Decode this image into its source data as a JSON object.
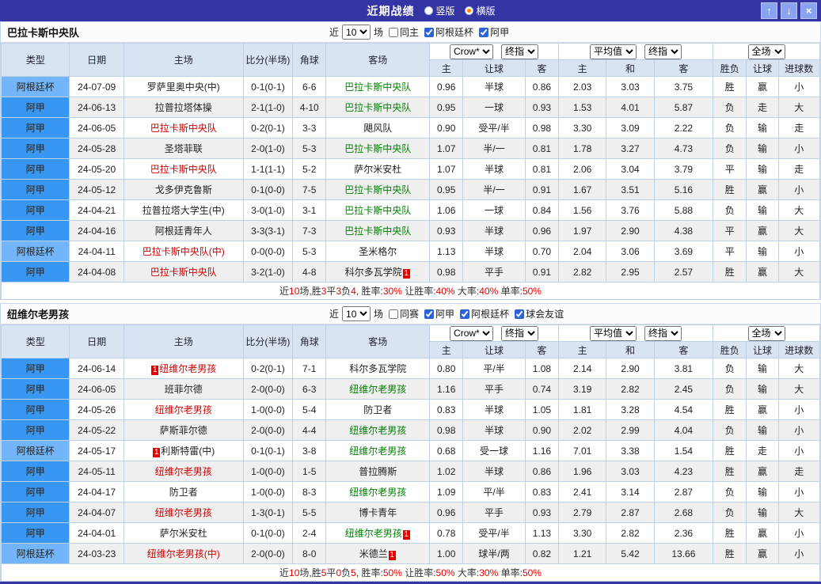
{
  "titlebar": {
    "title": "近期战绩",
    "radios": [
      {
        "label": "竖版",
        "selected": false
      },
      {
        "label": "横版",
        "selected": true
      }
    ],
    "buttons": {
      "up": "↑",
      "down": "↓",
      "close": "×"
    }
  },
  "sections": [
    {
      "team": "巴拉卡斯中央队",
      "filter": {
        "near_label": "近",
        "count": "10",
        "games_label": "场",
        "checkboxes": [
          {
            "label": "同主",
            "checked": false
          },
          {
            "label": "阿根廷杯",
            "checked": true
          },
          {
            "label": "阿甲",
            "checked": true
          }
        ]
      },
      "header": {
        "cols": [
          "类型",
          "日期",
          "主场",
          "比分(半场)",
          "角球",
          "客场"
        ],
        "selects1": [
          "Crow*",
          "终指"
        ],
        "selects2": [
          "平均值",
          "终指"
        ],
        "selects3": [
          "全场"
        ],
        "sub": [
          "主",
          "让球",
          "客",
          "主",
          "和",
          "客",
          "胜负",
          "让球",
          "进球数"
        ]
      },
      "rows": [
        {
          "type": "阿根廷杯",
          "type_style": "cup",
          "date": "24-07-09",
          "home": {
            "name": "罗萨里奥中央(中)",
            "color": "k"
          },
          "score": "0-1(0-1)",
          "corner": "6-6",
          "away": {
            "name": "巴拉卡斯中央队",
            "color": "g"
          },
          "odds": [
            "0.96",
            "半球",
            "0.86",
            "2.03",
            "3.03",
            "3.75"
          ],
          "results": [
            [
              "胜",
              "red"
            ],
            [
              "赢",
              "red"
            ],
            [
              "小",
              "green"
            ]
          ]
        },
        {
          "type": "阿甲",
          "type_style": "lg",
          "date": "24-06-13",
          "home": {
            "name": "拉普拉塔体操",
            "color": "k"
          },
          "score": "2-1(1-0)",
          "corner": "4-10",
          "away": {
            "name": "巴拉卡斯中央队",
            "color": "g"
          },
          "odds": [
            "0.95",
            "一球",
            "0.93",
            "1.53",
            "4.01",
            "5.87"
          ],
          "results": [
            [
              "负",
              "green"
            ],
            [
              "走",
              "green"
            ],
            [
              "大",
              "red"
            ]
          ]
        },
        {
          "type": "阿甲",
          "type_style": "lg",
          "date": "24-06-05",
          "home": {
            "name": "巴拉卡斯中央队",
            "color": "r"
          },
          "score": "0-2(0-1)",
          "corner": "3-3",
          "away": {
            "name": "飓风队",
            "color": "k"
          },
          "odds": [
            "0.90",
            "受平/半",
            "0.98",
            "3.30",
            "3.09",
            "2.22"
          ],
          "results": [
            [
              "负",
              "green"
            ],
            [
              "输",
              "green"
            ],
            [
              "走",
              "green"
            ]
          ]
        },
        {
          "type": "阿甲",
          "type_style": "lg",
          "date": "24-05-28",
          "home": {
            "name": "圣塔菲联",
            "color": "k"
          },
          "score": "2-0(1-0)",
          "corner": "5-3",
          "away": {
            "name": "巴拉卡斯中央队",
            "color": "g"
          },
          "odds": [
            "1.07",
            "半/一",
            "0.81",
            "1.78",
            "3.27",
            "4.73"
          ],
          "results": [
            [
              "负",
              "green"
            ],
            [
              "输",
              "green"
            ],
            [
              "小",
              "green"
            ]
          ]
        },
        {
          "type": "阿甲",
          "type_style": "lg",
          "date": "24-05-20",
          "home": {
            "name": "巴拉卡斯中央队",
            "color": "r"
          },
          "score": "1-1(1-1)",
          "corner": "5-2",
          "away": {
            "name": "萨尔米安杜",
            "color": "k"
          },
          "odds": [
            "1.07",
            "半球",
            "0.81",
            "2.06",
            "3.04",
            "3.79"
          ],
          "results": [
            [
              "平",
              "blue"
            ],
            [
              "输",
              "green"
            ],
            [
              "走",
              "green"
            ]
          ]
        },
        {
          "type": "阿甲",
          "type_style": "lg",
          "date": "24-05-12",
          "home": {
            "name": "戈多伊克鲁斯",
            "color": "k"
          },
          "score": "0-1(0-0)",
          "corner": "7-5",
          "away": {
            "name": "巴拉卡斯中央队",
            "color": "g"
          },
          "odds": [
            "0.95",
            "半/一",
            "0.91",
            "1.67",
            "3.51",
            "5.16"
          ],
          "results": [
            [
              "胜",
              "red"
            ],
            [
              "赢",
              "red"
            ],
            [
              "小",
              "green"
            ]
          ]
        },
        {
          "type": "阿甲",
          "type_style": "lg",
          "date": "24-04-21",
          "home": {
            "name": "拉普拉塔大学生(中)",
            "color": "k"
          },
          "score": "3-0(1-0)",
          "corner": "3-1",
          "away": {
            "name": "巴拉卡斯中央队",
            "color": "g"
          },
          "odds": [
            "1.06",
            "一球",
            "0.84",
            "1.56",
            "3.76",
            "5.88"
          ],
          "results": [
            [
              "负",
              "green"
            ],
            [
              "输",
              "green"
            ],
            [
              "大",
              "red"
            ]
          ]
        },
        {
          "type": "阿甲",
          "type_style": "lg",
          "date": "24-04-16",
          "home": {
            "name": "阿根廷青年人",
            "color": "k"
          },
          "score": "3-3(3-1)",
          "corner": "7-3",
          "away": {
            "name": "巴拉卡斯中央队",
            "color": "g"
          },
          "odds": [
            "0.93",
            "半球",
            "0.96",
            "1.97",
            "2.90",
            "4.38"
          ],
          "results": [
            [
              "平",
              "blue"
            ],
            [
              "赢",
              "red"
            ],
            [
              "大",
              "red"
            ]
          ]
        },
        {
          "type": "阿根廷杯",
          "type_style": "cup",
          "date": "24-04-11",
          "home": {
            "name": "巴拉卡斯中央队(中)",
            "color": "r"
          },
          "score": "0-0(0-0)",
          "corner": "5-3",
          "away": {
            "name": "圣米格尔",
            "color": "k"
          },
          "odds": [
            "1.13",
            "半球",
            "0.70",
            "2.04",
            "3.06",
            "3.69"
          ],
          "results": [
            [
              "平",
              "blue"
            ],
            [
              "输",
              "green"
            ],
            [
              "小",
              "green"
            ]
          ]
        },
        {
          "type": "阿甲",
          "type_style": "lg",
          "date": "24-04-08",
          "home": {
            "name": "巴拉卡斯中央队",
            "color": "r"
          },
          "score": "3-2(1-0)",
          "corner": "4-8",
          "away": {
            "name": "科尔多瓦学院",
            "color": "k",
            "badge_after": "1"
          },
          "odds": [
            "0.98",
            "平手",
            "0.91",
            "2.82",
            "2.95",
            "2.57"
          ],
          "results": [
            [
              "胜",
              "red"
            ],
            [
              "赢",
              "red"
            ],
            [
              "大",
              "red"
            ]
          ]
        }
      ],
      "summary": [
        [
          "近",
          0
        ],
        [
          "10",
          1
        ],
        [
          "场,胜",
          0
        ],
        [
          "3",
          1
        ],
        [
          "平",
          0
        ],
        [
          "3",
          1
        ],
        [
          "负",
          0
        ],
        [
          "4",
          1
        ],
        [
          ", 胜率:",
          0
        ],
        [
          "30%",
          1
        ],
        [
          " 让胜率:",
          0
        ],
        [
          "40%",
          1
        ],
        [
          " 大率:",
          0
        ],
        [
          "40%",
          1
        ],
        [
          " 单率:",
          0
        ],
        [
          "50%",
          1
        ]
      ]
    },
    {
      "team": "纽维尔老男孩",
      "filter": {
        "near_label": "近",
        "count": "10",
        "games_label": "场",
        "checkboxes": [
          {
            "label": "同赛",
            "checked": false
          },
          {
            "label": "阿甲",
            "checked": true
          },
          {
            "label": "阿根廷杯",
            "checked": true
          },
          {
            "label": "球会友谊",
            "checked": true
          }
        ]
      },
      "header": {
        "cols": [
          "类型",
          "日期",
          "主场",
          "比分(半场)",
          "角球",
          "客场"
        ],
        "selects1": [
          "Crow*",
          "终指"
        ],
        "selects2": [
          "平均值",
          "终指"
        ],
        "selects3": [
          "全场"
        ],
        "sub": [
          "主",
          "让球",
          "客",
          "主",
          "和",
          "客",
          "胜负",
          "让球",
          "进球数"
        ]
      },
      "rows": [
        {
          "type": "阿甲",
          "type_style": "lg",
          "date": "24-06-14",
          "home": {
            "name": "纽维尔老男孩",
            "color": "r",
            "badge_before": "1"
          },
          "score": "0-2(0-1)",
          "corner": "7-1",
          "away": {
            "name": "科尔多瓦学院",
            "color": "k"
          },
          "odds": [
            "0.80",
            "平/半",
            "1.08",
            "2.14",
            "2.90",
            "3.81"
          ],
          "results": [
            [
              "负",
              "green"
            ],
            [
              "输",
              "green"
            ],
            [
              "大",
              "red"
            ]
          ]
        },
        {
          "type": "阿甲",
          "type_style": "lg",
          "date": "24-06-05",
          "home": {
            "name": "班菲尔德",
            "color": "k"
          },
          "score": "2-0(0-0)",
          "corner": "6-3",
          "away": {
            "name": "纽维尔老男孩",
            "color": "g"
          },
          "odds": [
            "1.16",
            "平手",
            "0.74",
            "3.19",
            "2.82",
            "2.45"
          ],
          "results": [
            [
              "负",
              "green"
            ],
            [
              "输",
              "green"
            ],
            [
              "大",
              "red"
            ]
          ]
        },
        {
          "type": "阿甲",
          "type_style": "lg",
          "date": "24-05-26",
          "home": {
            "name": "纽维尔老男孩",
            "color": "r"
          },
          "score": "1-0(0-0)",
          "corner": "5-4",
          "away": {
            "name": "防卫者",
            "color": "k"
          },
          "odds": [
            "0.83",
            "半球",
            "1.05",
            "1.81",
            "3.28",
            "4.54"
          ],
          "results": [
            [
              "胜",
              "red"
            ],
            [
              "赢",
              "red"
            ],
            [
              "小",
              "green"
            ]
          ]
        },
        {
          "type": "阿甲",
          "type_style": "lg",
          "date": "24-05-22",
          "home": {
            "name": "萨斯菲尔德",
            "color": "k"
          },
          "score": "2-0(0-0)",
          "corner": "4-4",
          "away": {
            "name": "纽维尔老男孩",
            "color": "g"
          },
          "odds": [
            "0.98",
            "半球",
            "0.90",
            "2.02",
            "2.99",
            "4.04"
          ],
          "results": [
            [
              "负",
              "green"
            ],
            [
              "输",
              "green"
            ],
            [
              "小",
              "green"
            ]
          ]
        },
        {
          "type": "阿根廷杯",
          "type_style": "cup",
          "date": "24-05-17",
          "home": {
            "name": "利斯特雷(中)",
            "color": "k",
            "badge_before": "1"
          },
          "score": "0-1(0-1)",
          "corner": "3-8",
          "away": {
            "name": "纽维尔老男孩",
            "color": "g"
          },
          "odds": [
            "0.68",
            "受一球",
            "1.16",
            "7.01",
            "3.38",
            "1.54"
          ],
          "results": [
            [
              "胜",
              "red"
            ],
            [
              "走",
              "green"
            ],
            [
              "小",
              "green"
            ]
          ]
        },
        {
          "type": "阿甲",
          "type_style": "lg",
          "date": "24-05-11",
          "home": {
            "name": "纽维尔老男孩",
            "color": "r"
          },
          "score": "1-0(0-0)",
          "corner": "1-5",
          "away": {
            "name": "普拉腾斯",
            "color": "k"
          },
          "odds": [
            "1.02",
            "半球",
            "0.86",
            "1.96",
            "3.03",
            "4.23"
          ],
          "results": [
            [
              "胜",
              "red"
            ],
            [
              "赢",
              "red"
            ],
            [
              "走",
              "green"
            ]
          ]
        },
        {
          "type": "阿甲",
          "type_style": "lg",
          "date": "24-04-17",
          "home": {
            "name": "防卫者",
            "color": "k"
          },
          "score": "1-0(0-0)",
          "corner": "8-3",
          "away": {
            "name": "纽维尔老男孩",
            "color": "g"
          },
          "odds": [
            "1.09",
            "平/半",
            "0.83",
            "2.41",
            "3.14",
            "2.87"
          ],
          "results": [
            [
              "负",
              "green"
            ],
            [
              "输",
              "green"
            ],
            [
              "小",
              "green"
            ]
          ]
        },
        {
          "type": "阿甲",
          "type_style": "lg",
          "date": "24-04-07",
          "home": {
            "name": "纽维尔老男孩",
            "color": "r"
          },
          "score": "1-3(0-1)",
          "corner": "5-5",
          "away": {
            "name": "博卡青年",
            "color": "k"
          },
          "odds": [
            "0.96",
            "平手",
            "0.93",
            "2.79",
            "2.87",
            "2.68"
          ],
          "results": [
            [
              "负",
              "green"
            ],
            [
              "输",
              "green"
            ],
            [
              "大",
              "red"
            ]
          ]
        },
        {
          "type": "阿甲",
          "type_style": "lg",
          "date": "24-04-01",
          "home": {
            "name": "萨尔米安杜",
            "color": "k"
          },
          "score": "0-1(0-0)",
          "corner": "2-4",
          "away": {
            "name": "纽维尔老男孩",
            "color": "g",
            "badge_after": "1"
          },
          "odds": [
            "0.78",
            "受平/半",
            "1.13",
            "3.30",
            "2.82",
            "2.36"
          ],
          "results": [
            [
              "胜",
              "red"
            ],
            [
              "赢",
              "red"
            ],
            [
              "小",
              "green"
            ]
          ]
        },
        {
          "type": "阿根廷杯",
          "type_style": "cup",
          "date": "24-03-23",
          "home": {
            "name": "纽维尔老男孩(中)",
            "color": "r"
          },
          "score": "2-0(0-0)",
          "corner": "8-0",
          "away": {
            "name": "米德兰",
            "color": "k",
            "badge_after": "1"
          },
          "odds": [
            "1.00",
            "球半/两",
            "0.82",
            "1.21",
            "5.42",
            "13.66"
          ],
          "results": [
            [
              "胜",
              "red"
            ],
            [
              "赢",
              "red"
            ],
            [
              "小",
              "green"
            ]
          ]
        }
      ],
      "summary": [
        [
          "近",
          0
        ],
        [
          "10",
          1
        ],
        [
          "场,胜",
          0
        ],
        [
          "5",
          1
        ],
        [
          "平",
          0
        ],
        [
          "0",
          1
        ],
        [
          "负",
          0
        ],
        [
          "5",
          1
        ],
        [
          ", 胜率:",
          0
        ],
        [
          "50%",
          1
        ],
        [
          " 让胜率:",
          0
        ],
        [
          "50%",
          1
        ],
        [
          " 大率:",
          0
        ],
        [
          "30%",
          1
        ],
        [
          " 单率:",
          0
        ],
        [
          "50%",
          1
        ]
      ]
    }
  ]
}
